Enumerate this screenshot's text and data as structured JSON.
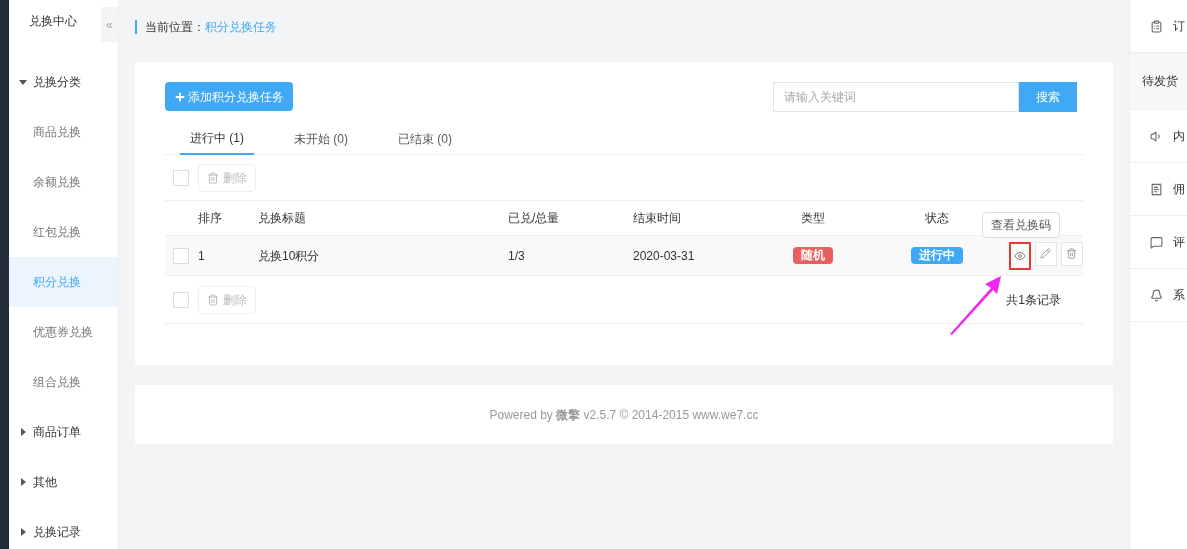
{
  "sidebar": {
    "title": "兑换中心",
    "collapse_glyph": "«",
    "groups": [
      {
        "label": "兑换分类",
        "expanded": true,
        "children": [
          {
            "label": "商品兑换",
            "selected": false
          },
          {
            "label": "余额兑换",
            "selected": false
          },
          {
            "label": "红包兑换",
            "selected": false
          },
          {
            "label": "积分兑换",
            "selected": true
          },
          {
            "label": "优惠券兑换",
            "selected": false
          },
          {
            "label": "组合兑换",
            "selected": false
          }
        ]
      },
      {
        "label": "商品订单",
        "expanded": false
      },
      {
        "label": "其他",
        "expanded": false
      },
      {
        "label": "兑换记录",
        "expanded": false
      }
    ]
  },
  "breadcrumb": {
    "label": "当前位置：",
    "current": "积分兑换任务"
  },
  "toolbar": {
    "add_button": "添加积分兑换任务",
    "search": {
      "placeholder": "请输入关键词",
      "button": "搜索"
    }
  },
  "tabs": [
    {
      "label": "进行中 (1)",
      "selected": true
    },
    {
      "label": "未开始 (0)",
      "selected": false
    },
    {
      "label": "已结束 (0)",
      "selected": false
    }
  ],
  "bulk_top": {
    "checked": false,
    "delete": "删除"
  },
  "bulk_bottom": {
    "checked": false,
    "delete": "删除"
  },
  "table": {
    "columns": [
      "排序",
      "兑换标题",
      "已兑/总量",
      "结束时间",
      "类型",
      "状态"
    ],
    "rows": [
      {
        "checked": false,
        "order": "1",
        "title": "兑换10积分",
        "redeemed": "1/3",
        "end_time": "2020-03-31",
        "type": {
          "label": "随机",
          "color": "#e85f5f"
        },
        "status": {
          "label": "进行中",
          "color": "#3fa9f5"
        }
      }
    ]
  },
  "tooltip": "查看兑换码",
  "record_count": "共1条记录",
  "footer": "Powered by **微擎** v2.5.7 © 2014-2015 www.we7.cc",
  "right_panel": [
    {
      "label": "订",
      "selected": false
    },
    {
      "label": "待发货",
      "selected": true
    },
    {
      "label": "内",
      "selected": false
    },
    {
      "label": "佣",
      "selected": false
    },
    {
      "label": "评",
      "selected": false
    },
    {
      "label": "系",
      "selected": false
    }
  ]
}
